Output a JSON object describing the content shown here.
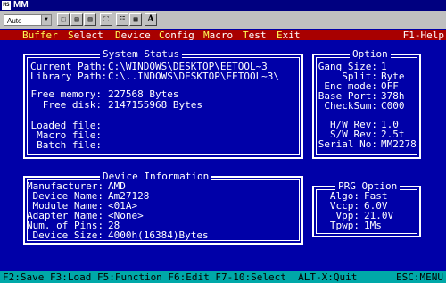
{
  "window": {
    "title": "MM"
  },
  "toolbar": {
    "font_select": "Auto",
    "a_button": "A"
  },
  "menu": {
    "items": [
      {
        "hk": "B",
        "rest": "uffer"
      },
      {
        "hk": "S",
        "rest": "elect"
      },
      {
        "hk": "D",
        "rest": "evice"
      },
      {
        "hk": "C",
        "rest": "onfig"
      },
      {
        "hk": "M",
        "rest": "acro"
      },
      {
        "hk": "T",
        "rest": "est"
      },
      {
        "hk": "E",
        "rest": "xit"
      }
    ],
    "help": "F1-Help"
  },
  "system_status": {
    "title": "System Status",
    "current_path_label": "Current Path:",
    "current_path": "C:\\WINDOWS\\DESKTOP\\EETOOL~3",
    "library_path_label": "Library Path:",
    "library_path": "C:\\..INDOWS\\DESKTOP\\EETOOL~3\\",
    "free_memory_label": "Free memory:",
    "free_memory": "227568 Bytes",
    "free_disk_label": "Free disk:",
    "free_disk": "2147155968 Bytes",
    "loaded_file_label": "Loaded file:",
    "macro_file_label": "Macro file:",
    "batch_file_label": "Batch file:"
  },
  "option": {
    "title": "Option",
    "gang_size_label": "Gang Size:",
    "gang_size": "1",
    "split_label": "Split:",
    "split": "Byte",
    "enc_mode_label": "Enc mode:",
    "enc_mode": "OFF",
    "base_port_label": "Base Port:",
    "base_port": "378h",
    "checksum_label": "CheckSum:",
    "checksum": "C000",
    "hw_rev_label": "H/W Rev:",
    "hw_rev": "1.0",
    "sw_rev_label": "S/W Rev:",
    "sw_rev": "2.5t",
    "serial_label": "Serial No:",
    "serial": "MM2278"
  },
  "device_info": {
    "title": "Device Information",
    "manufacturer_label": "Manufacturer:",
    "manufacturer": "AMD",
    "device_name_label": "Device Name:",
    "device_name": "Am27128",
    "module_name_label": "Module Name:",
    "module_name": "<01A>",
    "adapter_name_label": "Adapter Name:",
    "adapter_name": "<None>",
    "num_pins_label": "Num. of Pins:",
    "num_pins": "28",
    "device_size_label": "Device Size:",
    "device_size": "4000h(16384)Bytes"
  },
  "prg_option": {
    "title": "PRG Option",
    "algo_label": "Algo:",
    "algo": "Fast",
    "vccp_label": "Vccp:",
    "vccp": "6.0V",
    "vpp_label": "Vpp:",
    "vpp": "21.0V",
    "tpwp_label": "Tpwp:",
    "tpwp": "1Ms"
  },
  "statusbar": {
    "left": "F2:Save F3:Load F5:Function F6:Edit F7-10:Select  ALT-X:Quit",
    "right": "ESC:MENU"
  }
}
